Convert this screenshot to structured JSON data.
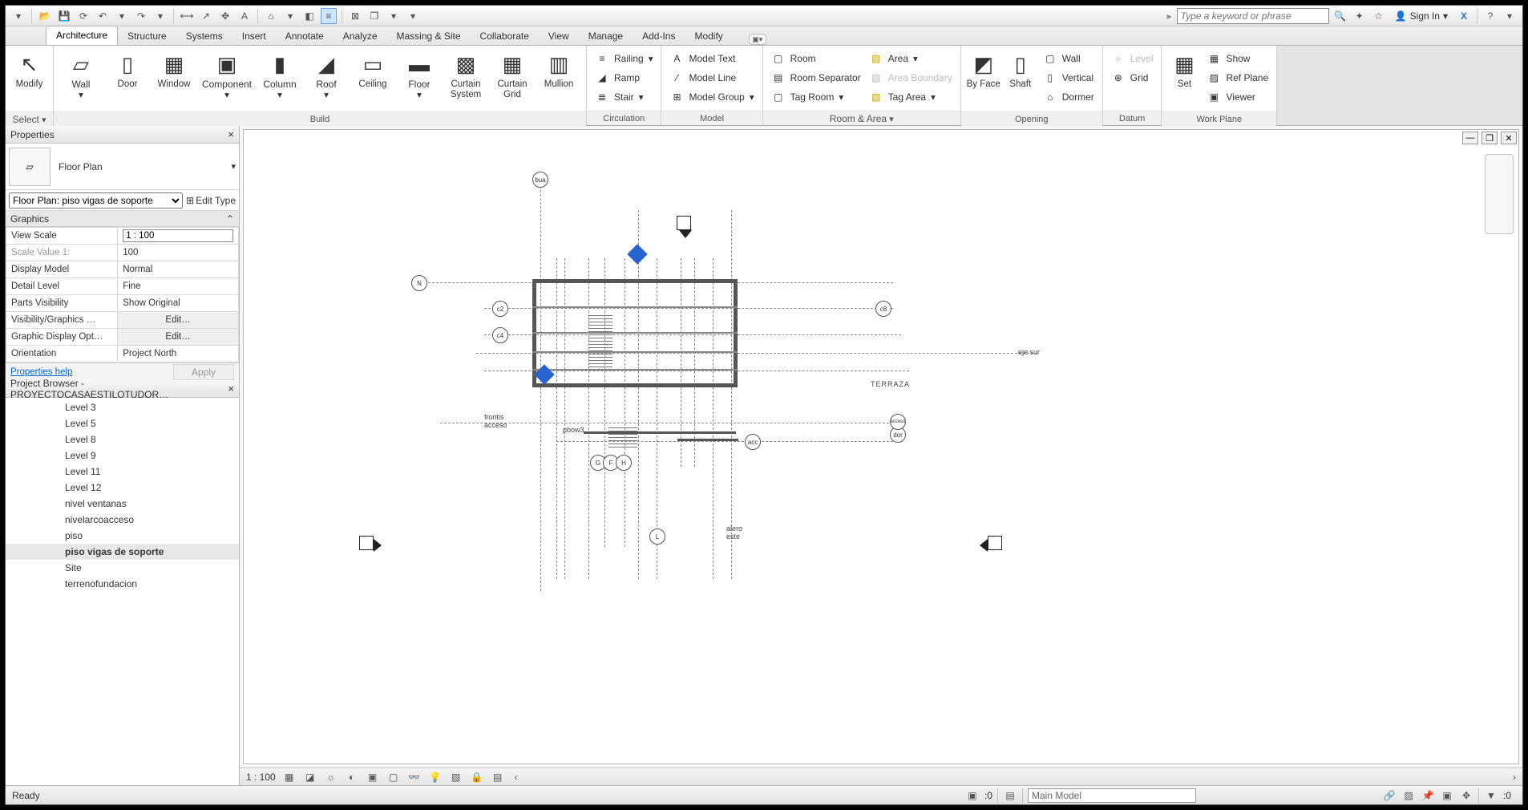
{
  "qat": {
    "search_placeholder": "Type a keyword or phrase",
    "signin": "Sign In"
  },
  "tabs": [
    "Architecture",
    "Structure",
    "Systems",
    "Insert",
    "Annotate",
    "Analyze",
    "Massing & Site",
    "Collaborate",
    "View",
    "Manage",
    "Add-Ins",
    "Modify"
  ],
  "active_tab": "Architecture",
  "ribbon": {
    "select": "Select",
    "modify": "Modify",
    "build": {
      "title": "Build",
      "wall": "Wall",
      "door": "Door",
      "window": "Window",
      "component": "Component",
      "column": "Column",
      "roof": "Roof",
      "ceiling": "Ceiling",
      "floor": "Floor",
      "curtain_system": "Curtain System",
      "curtain_grid": "Curtain Grid",
      "mullion": "Mullion"
    },
    "circulation": {
      "title": "Circulation",
      "railing": "Railing",
      "ramp": "Ramp",
      "stair": "Stair"
    },
    "model": {
      "title": "Model",
      "text": "Model   Text",
      "line": "Model   Line",
      "group": "Model   Group"
    },
    "room_area": {
      "title": "Room & Area",
      "room": "Room",
      "sep": "Room   Separator",
      "tag_room": "Tag   Room",
      "area": "Area",
      "boundary": "Area   Boundary",
      "tag_area": "Tag   Area"
    },
    "opening": {
      "title": "Opening",
      "byface": "By Face",
      "shaft": "Shaft",
      "wall": "Wall",
      "vertical": "Vertical",
      "dormer": "Dormer"
    },
    "datum": {
      "title": "Datum",
      "level": "Level",
      "grid": "Grid"
    },
    "set": "Set",
    "workplane": {
      "title": "Work Plane",
      "show": "Show",
      "ref": "Ref   Plane",
      "viewer": "Viewer"
    }
  },
  "properties": {
    "title": "Properties",
    "type": "Floor Plan",
    "instance": "Floor Plan: piso  vigas de soporte",
    "edit_type": "Edit Type",
    "graphics": "Graphics",
    "rows": [
      {
        "k": "View Scale",
        "v": "1 : 100",
        "input": true
      },
      {
        "k": "Scale Value    1:",
        "v": "100",
        "gray": true
      },
      {
        "k": "Display Model",
        "v": "Normal"
      },
      {
        "k": "Detail Level",
        "v": "Fine"
      },
      {
        "k": "Parts Visibility",
        "v": "Show Original"
      },
      {
        "k": "Visibility/Graphics …",
        "v": "Edit…",
        "btn": true
      },
      {
        "k": "Graphic Display Opt…",
        "v": "Edit…",
        "btn": true
      },
      {
        "k": "Orientation",
        "v": "Project North"
      }
    ],
    "help": "Properties help",
    "apply": "Apply"
  },
  "browser": {
    "title": "Project Browser - PROYECTOCASAESTILOTUDOR…",
    "items": [
      "Level 3",
      "Level 5",
      "Level 8",
      "Level 9",
      "Level 11",
      "Level 12",
      "nivel ventanas",
      "nivelarcoacceso",
      "piso",
      "piso  vigas de soporte",
      "Site",
      "terrenofundacion"
    ],
    "active": "piso  vigas de soporte"
  },
  "canvas": {
    "scale": "1 : 100",
    "grid_bubbles": [
      "bua",
      "N",
      "c2",
      "c4",
      "c8",
      "acc",
      "G",
      "F",
      "H",
      "L",
      "dor",
      "acceso"
    ],
    "texts": [
      "frontis",
      "acceso",
      "pbow3",
      "TERRAZA",
      "alero",
      "este"
    ]
  },
  "status": {
    "ready": "Ready",
    "zero": ":0",
    "main_model": "Main Model"
  }
}
